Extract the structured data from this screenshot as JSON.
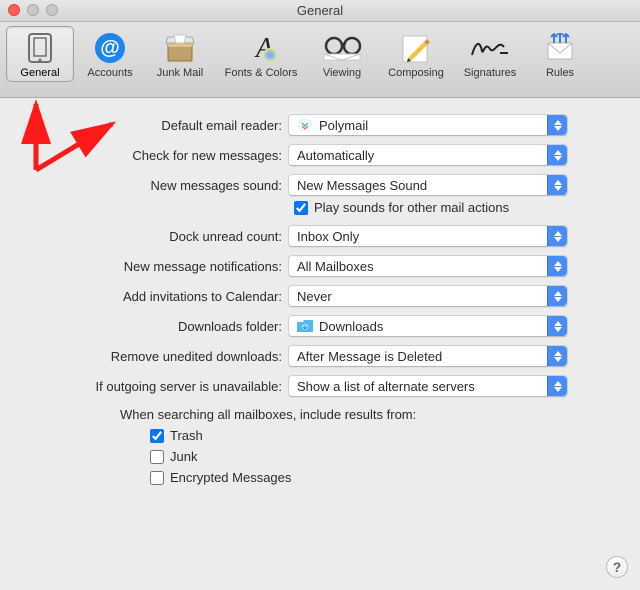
{
  "window": {
    "title": "General"
  },
  "toolbar": {
    "items": [
      {
        "label": "General"
      },
      {
        "label": "Accounts"
      },
      {
        "label": "Junk Mail"
      },
      {
        "label": "Fonts & Colors"
      },
      {
        "label": "Viewing"
      },
      {
        "label": "Composing"
      },
      {
        "label": "Signatures"
      },
      {
        "label": "Rules"
      }
    ]
  },
  "settings": {
    "defaultReader": {
      "label": "Default email reader:",
      "value": "Polymail"
    },
    "checkMessages": {
      "label": "Check for new messages:",
      "value": "Automatically"
    },
    "newMsgSound": {
      "label": "New messages sound:",
      "value": "New Messages Sound"
    },
    "playOtherSounds": {
      "label": "Play sounds for other mail actions",
      "checked": true
    },
    "dockCount": {
      "label": "Dock unread count:",
      "value": "Inbox Only"
    },
    "notifications": {
      "label": "New message notifications:",
      "value": "All Mailboxes"
    },
    "addInvites": {
      "label": "Add invitations to Calendar:",
      "value": "Never"
    },
    "downloadsFolder": {
      "label": "Downloads folder:",
      "value": "Downloads"
    },
    "removeDownloads": {
      "label": "Remove unedited downloads:",
      "value": "After Message is Deleted"
    },
    "outgoingUnavail": {
      "label": "If outgoing server is unavailable:",
      "value": "Show a list of alternate servers"
    },
    "searchInclude": {
      "heading": "When searching all mailboxes, include results from:",
      "trash": {
        "label": "Trash",
        "checked": true
      },
      "junk": {
        "label": "Junk",
        "checked": false
      },
      "encrypted": {
        "label": "Encrypted Messages",
        "checked": false
      }
    }
  }
}
